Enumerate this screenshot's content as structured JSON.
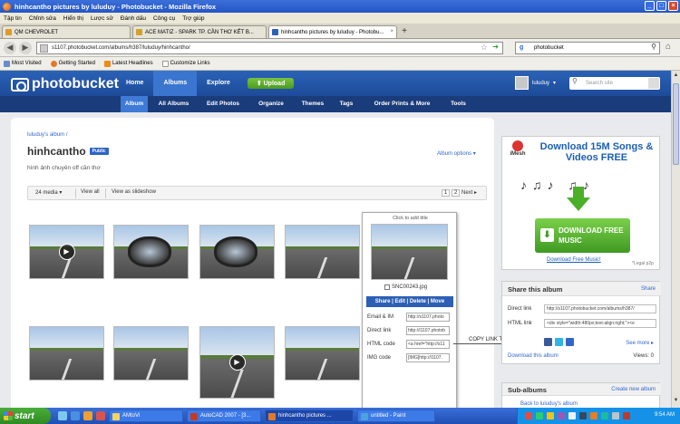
{
  "window": {
    "title": "hinhcantho pictures by luluduy - Photobucket - Mozilla Firefox"
  },
  "menu": [
    "Tập tin",
    "Chỉnh sửa",
    "Hiển thị",
    "Lược sử",
    "Đánh dấu",
    "Công cụ",
    "Trợ giúp"
  ],
  "tabs": [
    {
      "label": "QM CHEVROLET"
    },
    {
      "label": "ACE MATIZ - SPARK TP. CẦN THƠ KẾT B..."
    },
    {
      "label": "hinhcantho pictures by luluduy - Photobu..."
    }
  ],
  "address": {
    "url": "s1107.photobucket.com/albums/h387/luluduy/hinhcantho/",
    "search_value": "photobucket"
  },
  "bookmarks": [
    "Most Visited",
    "Getting Started",
    "Latest Headlines",
    "Customize Links"
  ],
  "pb": {
    "logo": "photobucket",
    "nav": [
      "Home",
      "Albums",
      "Explore"
    ],
    "upload": "Upload",
    "username": "luluduy",
    "search_placeholder": "Search site",
    "subnav": [
      "Album",
      "All Albums",
      "Edit Photos",
      "Organize",
      "Themes",
      "Tags",
      "Order Prints & More",
      "Tools"
    ]
  },
  "album": {
    "breadcrumb": "luluduy's album /",
    "title": "hinhcantho",
    "badge": "Public",
    "options": "Album options ▾",
    "description": "hình ảnh chuyên off cần thơ",
    "media_count": "24 media ▾",
    "view_all": "View all",
    "view_slideshow": "View as slideshow",
    "page1": "1",
    "page2": "2",
    "next": "Next"
  },
  "popup": {
    "click_title": "Click to add title",
    "filename": "SNC00243.jpg",
    "actions": "Share | Edit | Delete | Move",
    "rows": [
      {
        "label": "Email & IM",
        "value": "http://s1107.photo"
      },
      {
        "label": "Direct link",
        "value": "http://i1107.photob"
      },
      {
        "label": "HTML code",
        "value": "<a href=\"http://s11"
      },
      {
        "label": "IMG code",
        "value": "[IMG]http://i1107."
      }
    ]
  },
  "callout": "COPY LINK TẠI ĐÂY",
  "ad": {
    "brand": "iMesh",
    "headline": "Download 15M Songs & Videos FREE",
    "button": "DOWNLOAD FREE MUSIC",
    "link": "Download Free Music!",
    "note": "*Legal p2p"
  },
  "share": {
    "title": "Share this album",
    "share_link": "Share",
    "direct_label": "Direct link",
    "direct_value": "http://s1107.photobucket.com/albums/h387/",
    "html_label": "HTML link",
    "html_value": "<div style=\"width:480px;text-align:right;\"><e",
    "see_more": "See more ▸",
    "download": "Download this album",
    "views": "Views: 0"
  },
  "subalbums": {
    "title": "Sub-albums",
    "create": "Create new album",
    "back": "Back to luluduy's album"
  },
  "taskbar": {
    "start": "start",
    "tasks": [
      "AMtoVi",
      "AutoCAD 2007 - [3...",
      "hinhcantho pictures ...",
      "untitled - Paint"
    ],
    "clock": "9:54 AM"
  },
  "colors": {
    "pb_blue": "#2b62b7",
    "pb_subnav": "#1b3c7a",
    "upload_green": "#5ba92b",
    "taskbar_blue": "#245edb"
  }
}
